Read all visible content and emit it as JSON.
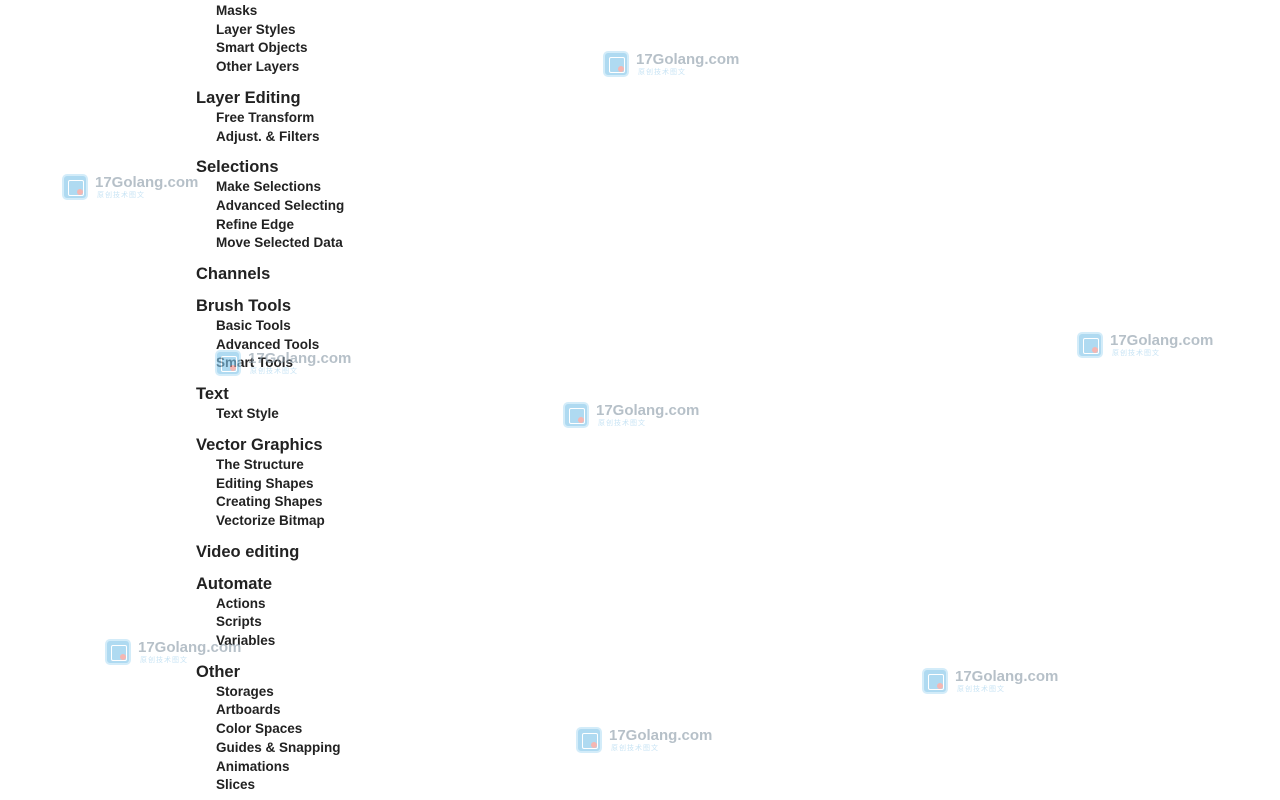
{
  "toc": {
    "first_items": [
      "Masks",
      "Layer Styles",
      "Smart Objects",
      "Other Layers"
    ],
    "sections": [
      {
        "title": "Layer Editing",
        "items": [
          "Free Transform",
          "Adjust. & Filters"
        ]
      },
      {
        "title": "Selections",
        "items": [
          "Make Selections",
          "Advanced Selecting",
          "Refine Edge",
          "Move Selected Data"
        ]
      },
      {
        "title": "Channels",
        "items": []
      },
      {
        "title": "Brush Tools",
        "items": [
          "Basic Tools",
          "Advanced Tools",
          "Smart Tools"
        ]
      },
      {
        "title": "Text",
        "items": [
          "Text Style"
        ]
      },
      {
        "title": "Vector Graphics",
        "items": [
          "The Structure",
          "Editing Shapes",
          "Creating Shapes",
          "Vectorize Bitmap"
        ]
      },
      {
        "title": "Video editing",
        "items": []
      },
      {
        "title": "Automate",
        "items": [
          "Actions",
          "Scripts",
          "Variables"
        ]
      },
      {
        "title": "Other",
        "items": [
          "Storages",
          "Artboards",
          "Color Spaces",
          "Guides & Snapping",
          "Animations",
          "Slices"
        ]
      }
    ]
  },
  "watermark": {
    "text": "17Golang.com",
    "subtext": "原创技术图文",
    "icon": "image-logo-icon",
    "color": "#7fc4ea"
  }
}
